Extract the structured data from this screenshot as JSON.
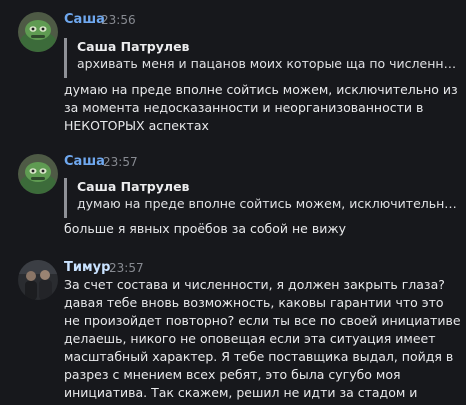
{
  "colors": {
    "background": "#17181c",
    "author_sasha": "#6fa8ef",
    "author_timur": "#c9e2ff",
    "timestamp": "#878a91",
    "quote_bar": "#8f9197"
  },
  "messages": [
    {
      "author": "Саша",
      "time": "23:56",
      "avatar_icon": "green-robot-avatar-icon",
      "quote": {
        "author": "Саша Патрулев",
        "text": "архивать меня и пацанов моих которые ща по численности…"
      },
      "text": "думаю на преде вполне сойтись можем, исключительно из за момента недосказанности и неорганизованности в НЕКОТОРЫХ аспектах"
    },
    {
      "author": "Саша",
      "time": "23:57",
      "avatar_icon": "green-robot-avatar-icon",
      "quote": {
        "author": "Саша Патрулев",
        "text": "думаю на преде вполне сойтись можем, исключительно из за …"
      },
      "text": "больше я явных проёбов за собой не вижу"
    },
    {
      "author": "Тимур",
      "time": "23:57",
      "avatar_icon": "person-photo-avatar-icon",
      "text": "За счет состава и численности, я должен закрыть глаза? давая тебе вновь возможность, каковы гарантии что это не произойдет повторно? если ты все по своей инициативе делаешь, никого не оповещая если эта ситуация имеет масштабный характер. Я тебе поставщика выдал, пойдя в разрез с мнением всех ребят, это была сугубо моя инициатива. Так скажем, решил не идти за стадом и"
    }
  ]
}
